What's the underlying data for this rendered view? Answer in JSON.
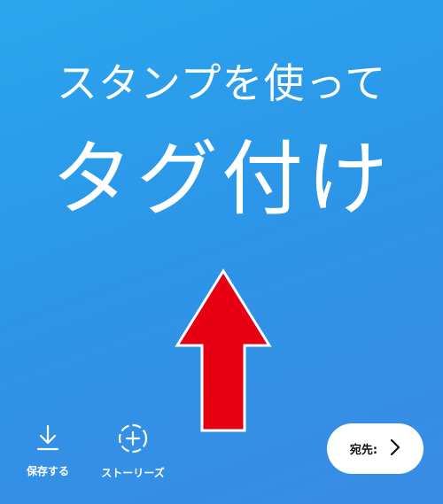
{
  "headline": {
    "line1": "スタンプを使って",
    "line2": "タグ付け"
  },
  "arrow": {
    "icon": "up-arrow-icon",
    "color": "#e60012",
    "outline": "#ffffff"
  },
  "bottom_bar": {
    "save": {
      "label": "保存する",
      "icon": "download-icon"
    },
    "stories": {
      "label": "ストーリーズ",
      "icon": "add-story-icon"
    },
    "send": {
      "label": "宛先:",
      "icon": "chevron-right-icon"
    }
  },
  "colors": {
    "background_top": "#2aa6ee",
    "background_bottom": "#3a8be3",
    "text": "#ffffff"
  }
}
